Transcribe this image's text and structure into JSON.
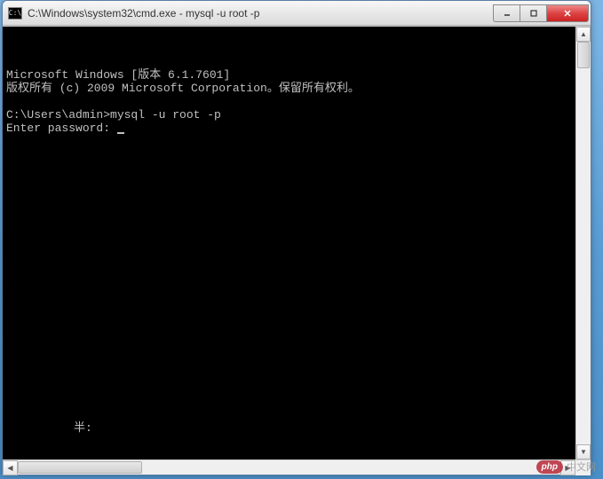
{
  "window": {
    "icon_label": "C:\\",
    "title": "C:\\Windows\\system32\\cmd.exe - mysql  -u root -p"
  },
  "terminal": {
    "lines": [
      "Microsoft Windows [版本 6.1.7601]",
      "版权所有 (c) 2009 Microsoft Corporation。保留所有权利。",
      "",
      "C:\\Users\\admin>mysql -u root -p",
      "Enter password:"
    ],
    "cursor_after_line": 4,
    "stray_text": "半:"
  },
  "watermark": {
    "badge": "php",
    "text": "中文网"
  }
}
